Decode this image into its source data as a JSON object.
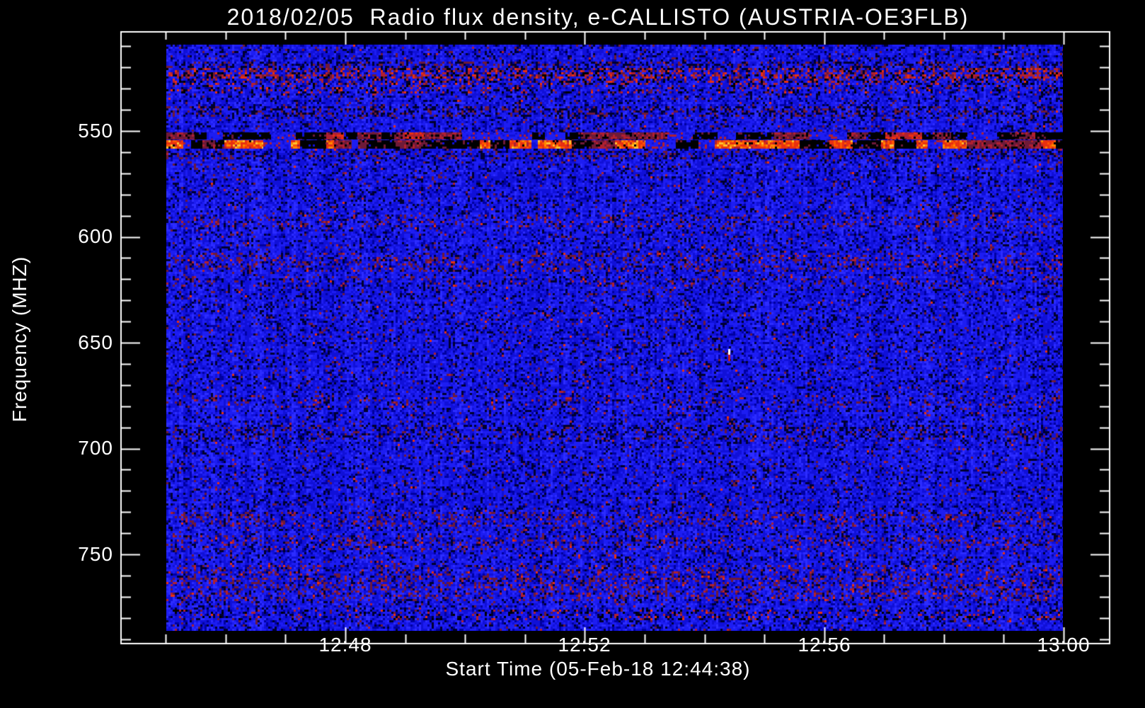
{
  "window": {
    "background": "#000000",
    "foreground": "#ffffff"
  },
  "chart_data": {
    "type": "heatmap",
    "subtype": "radio-spectrogram",
    "title": "2018/02/05  Radio flux density, e-CALLISTO (AUSTRIA-OE3FLB)",
    "xlabel": "Start Time (05-Feb-18 12:44:38)",
    "ylabel": "Frequency (MHZ)",
    "legend": "none",
    "grid": false,
    "x_axis": {
      "major_tick_labels": [
        "12:48",
        "12:52",
        "12:56",
        "13:00"
      ],
      "major_tick_minutes": [
        48,
        52,
        56,
        60
      ],
      "minor_tick_first_minute": 45,
      "minor_tick_last_minute": 60,
      "minor_tick_step_minutes": 1,
      "start_time_label": "12:44:38"
    },
    "y_axis": {
      "major_tick_labels": [
        "550",
        "600",
        "650",
        "700",
        "750"
      ],
      "major_tick_values_mhz": [
        550,
        600,
        650,
        700,
        750
      ],
      "minor_tick_step_mhz": 10,
      "minor_tick_min_mhz": 510,
      "minor_tick_max_mhz": 790,
      "direction": "increasing-downward"
    },
    "image_freq_range_mhz": [
      509,
      786
    ],
    "palette": {
      "blue_brightest": "#2c2cff",
      "blue_bright": "#1d1df2",
      "blue_mid": "#1010d8",
      "blue_dark": "#0000a0",
      "navy_fleck": "#000030",
      "maroon": "#6e1a38",
      "crimson": "#b02030",
      "red_bright": "#e83010",
      "orange_red": "#ff5500",
      "orange": "#ff8800",
      "yellow": "#ffc030",
      "black": "#000000",
      "white": "#ffffff"
    },
    "noise": {
      "maroon_speckle_p": 0.035,
      "crimson_speckle_p": 0.006,
      "bright_speckle_p": 0.0015,
      "black_fleck_p": 0.045
    },
    "bands": [
      {
        "f0": 517.5,
        "f1": 519.5,
        "type": "dark_mottle",
        "intensity": 0.3
      },
      {
        "f0": 520.5,
        "f1": 523.5,
        "type": "red_speckle",
        "intensity": 0.3
      },
      {
        "f0": 523.5,
        "f1": 527.0,
        "type": "red_speckle",
        "intensity": 0.16
      },
      {
        "f0": 528.5,
        "f1": 531.0,
        "type": "red_speckle",
        "intensity": 0.09
      },
      {
        "f0": 538.5,
        "f1": 541.5,
        "type": "dark_mottle",
        "intensity": 0.28
      },
      {
        "f0": 550.8,
        "f1": 554.0,
        "type": "rfi_dark",
        "intensity": 1.0
      },
      {
        "f0": 554.3,
        "f1": 558.5,
        "type": "rfi_bright",
        "intensity": 1.0
      },
      {
        "f0": 559.5,
        "f1": 562.5,
        "type": "dark_mottle",
        "intensity": 0.22
      },
      {
        "f0": 589.5,
        "f1": 594.5,
        "type": "red_mottle",
        "intensity": 0.1
      },
      {
        "f0": 607.5,
        "f1": 615.0,
        "type": "red_mottle",
        "intensity": 0.13
      },
      {
        "f0": 619.0,
        "f1": 622.5,
        "type": "red_mottle",
        "intensity": 0.08
      },
      {
        "f0": 675.5,
        "f1": 679.0,
        "type": "red_mottle",
        "intensity": 0.07
      },
      {
        "f0": 689.5,
        "f1": 694.0,
        "type": "dark_mottle",
        "intensity": 0.18
      },
      {
        "f0": 730.5,
        "f1": 736.0,
        "type": "red_mottle",
        "intensity": 0.14
      },
      {
        "f0": 741.5,
        "f1": 746.5,
        "type": "red_mottle",
        "intensity": 0.12
      },
      {
        "f0": 755.5,
        "f1": 760.5,
        "type": "red_mottle",
        "intensity": 0.13
      },
      {
        "f0": 761.0,
        "f1": 770.5,
        "type": "red_mottle",
        "intensity": 0.17
      },
      {
        "f0": 776.0,
        "f1": 780.0,
        "type": "red_speckle",
        "intensity": 0.08
      }
    ],
    "point_event": {
      "x_fraction": 0.627,
      "freq_mhz": 655,
      "color": "#ffffff",
      "tail_color": "#cc1818"
    }
  }
}
